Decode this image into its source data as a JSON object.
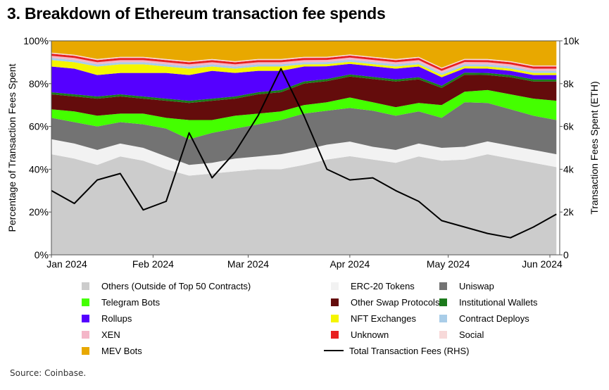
{
  "title": "3. Breakdown of Ethereum transaction fee spends",
  "source": "Source: Coinbase.",
  "chart_data": {
    "type": "area",
    "stacked": true,
    "title": "3. Breakdown of Ethereum transaction fee spends",
    "x": [
      "2024-01-01",
      "2024-01-08",
      "2024-01-15",
      "2024-01-22",
      "2024-01-29",
      "2024-02-05",
      "2024-02-12",
      "2024-02-19",
      "2024-02-26",
      "2024-03-04",
      "2024-03-11",
      "2024-03-18",
      "2024-03-25",
      "2024-04-01",
      "2024-04-08",
      "2024-04-15",
      "2024-04-22",
      "2024-04-29",
      "2024-05-06",
      "2024-05-13",
      "2024-05-20",
      "2024-05-27",
      "2024-06-03"
    ],
    "x_tick_labels": [
      "Jan 2024",
      "Feb 2024",
      "Mar 2024",
      "Apr 2024",
      "May 2024",
      "Jun 2024"
    ],
    "x_tick_dates": [
      "2024-01-01",
      "2024-02-01",
      "2024-03-01",
      "2024-04-01",
      "2024-05-01",
      "2024-06-01"
    ],
    "ylabel": "Percentage of Transaction Fees Spent",
    "ylim": [
      0,
      100
    ],
    "y_ticks": [
      "0%",
      "20%",
      "40%",
      "60%",
      "80%",
      "100%"
    ],
    "y2label": "Transaction Fees Spent (ETH)",
    "y2lim": [
      0,
      10000
    ],
    "y2_ticks": [
      "0",
      "2k",
      "4k",
      "6k",
      "8k",
      "10k"
    ],
    "grid": false,
    "legend_position": "bottom",
    "series": [
      {
        "name": "Others (Outside of Top 50 Contracts)",
        "color": "#cccccc",
        "values": [
          47,
          45,
          42,
          46,
          44,
          40,
          37,
          38,
          39,
          40,
          40,
          42,
          45,
          47,
          45,
          43,
          46,
          44,
          45,
          47,
          45,
          43,
          41
        ]
      },
      {
        "name": "ERC-20 Tokens",
        "color": "#f2f2f2",
        "values": [
          7,
          7,
          7,
          6,
          6,
          6,
          5,
          5,
          6,
          6,
          7,
          7,
          7,
          7,
          6,
          6,
          6,
          6,
          6,
          6,
          6,
          6,
          6
        ]
      },
      {
        "name": "Uniswap",
        "color": "#737373",
        "values": [
          10,
          10,
          11,
          10,
          11,
          13,
          12,
          14,
          14,
          15,
          16,
          17,
          16,
          16,
          17,
          16,
          15,
          14,
          21,
          18,
          17,
          16,
          16
        ]
      },
      {
        "name": "Telegram Bots",
        "color": "#44ff00",
        "values": [
          4,
          5,
          5,
          4,
          5,
          5,
          9,
          6,
          6,
          5,
          4,
          4,
          4,
          5,
          4,
          4,
          4,
          6,
          5,
          6,
          7,
          8,
          9
        ]
      },
      {
        "name": "Other Swap Protocols",
        "color": "#640c0c",
        "values": [
          7,
          7,
          8,
          8,
          7,
          8,
          8,
          9,
          8,
          9,
          9,
          10,
          10,
          10,
          11,
          12,
          11,
          8,
          8,
          7,
          8,
          8,
          9
        ]
      },
      {
        "name": "Institutional Wallets",
        "color": "#1b7a1b",
        "values": [
          1,
          1,
          1,
          1,
          1,
          1,
          1,
          1,
          1,
          1,
          1,
          1,
          1,
          1,
          1,
          1,
          1,
          1,
          1,
          1,
          1,
          1,
          1
        ]
      },
      {
        "name": "Rollups",
        "color": "#5500ff",
        "values": [
          12,
          12,
          10,
          10,
          11,
          12,
          12,
          13,
          11,
          10,
          9,
          7,
          6,
          5,
          5,
          5,
          5,
          4,
          2,
          2,
          2,
          2,
          2
        ]
      },
      {
        "name": "NFT Exchanges",
        "color": "#f5f500",
        "values": [
          3,
          3,
          4,
          4,
          4,
          3,
          3,
          2,
          2,
          2,
          2,
          1,
          1,
          1,
          1,
          1,
          1,
          1,
          1,
          1,
          1,
          1,
          1
        ]
      },
      {
        "name": "Contract Deploys",
        "color": "#a9cde8",
        "values": [
          1,
          1,
          1,
          1,
          1,
          1,
          1,
          1,
          1,
          1,
          1,
          1,
          1,
          1,
          1,
          1,
          1,
          1,
          1,
          1,
          1,
          1,
          1
        ]
      },
      {
        "name": "XEN",
        "color": "#f4b6c8",
        "values": [
          1,
          1,
          1,
          1,
          1,
          1,
          1,
          1,
          1,
          1,
          1,
          1,
          1,
          1,
          1,
          1,
          1,
          1,
          1,
          1,
          1,
          1,
          1
        ]
      },
      {
        "name": "Unknown",
        "color": "#e82020",
        "values": [
          1,
          1,
          1,
          1,
          1,
          1,
          1,
          1,
          1,
          1,
          1,
          1,
          1,
          1,
          1,
          1,
          1,
          1,
          1,
          1,
          1,
          1,
          1
        ]
      },
      {
        "name": "Social",
        "color": "#f7d9d9",
        "values": [
          0.5,
          0.5,
          0.5,
          0.5,
          0.5,
          0.5,
          0.5,
          0.5,
          0.5,
          0.5,
          0.5,
          0.5,
          0.5,
          0.5,
          0.5,
          0.5,
          0.5,
          0.5,
          0.5,
          0.5,
          0.5,
          0.5,
          0.5
        ]
      },
      {
        "name": "MEV Bots",
        "color": "#e8a800",
        "values": [
          5.5,
          6.5,
          8.5,
          7.5,
          7.5,
          8.5,
          9.5,
          8.5,
          9.5,
          8.5,
          8.5,
          7.5,
          7.5,
          6.5,
          7.5,
          8.5,
          7.5,
          12.5,
          8.5,
          8.5,
          9.5,
          11.5,
          11.5
        ]
      }
    ],
    "line_series": {
      "name": "Total Transaction Fees (RHS)",
      "axis": "right",
      "color": "#000000",
      "values": [
        3000,
        2400,
        3500,
        3800,
        2100,
        2500,
        5700,
        3600,
        4800,
        6500,
        8700,
        6500,
        4000,
        3500,
        3600,
        3000,
        2500,
        1600,
        1300,
        1000,
        800,
        1300,
        1900
      ]
    }
  },
  "legend": [
    {
      "label": "Others (Outside of Top 50 Contracts)",
      "color": "#cccccc"
    },
    {
      "label": "ERC-20 Tokens",
      "color": "#f2f2f2"
    },
    {
      "label": "Uniswap",
      "color": "#737373"
    },
    {
      "label": "Telegram Bots",
      "color": "#44ff00"
    },
    {
      "label": "Other Swap Protocols",
      "color": "#640c0c"
    },
    {
      "label": "Institutional Wallets",
      "color": "#1b7a1b"
    },
    {
      "label": "Rollups",
      "color": "#5500ff"
    },
    {
      "label": "NFT Exchanges",
      "color": "#f5f500"
    },
    {
      "label": "Contract Deploys",
      "color": "#a9cde8"
    },
    {
      "label": "XEN",
      "color": "#f4b6c8"
    },
    {
      "label": "Unknown",
      "color": "#e82020"
    },
    {
      "label": "Social",
      "color": "#f7d9d9"
    },
    {
      "label": "MEV Bots",
      "color": "#e8a800"
    },
    {
      "label": "Total Transaction Fees (RHS)",
      "color": "#000000",
      "kind": "line"
    }
  ]
}
